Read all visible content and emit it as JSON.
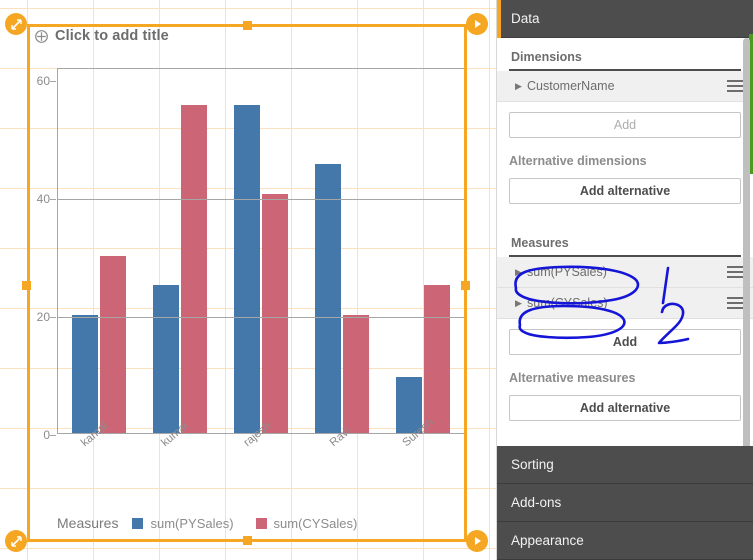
{
  "chart": {
    "title_placeholder": "Click to add title",
    "title_icon": "move-cross-icon",
    "legend_title": "Measures"
  },
  "chart_data": {
    "type": "bar",
    "title": "Click to add title",
    "categories": [
      "kamal",
      "kumar",
      "rajesh",
      "Ravi",
      "Suresh"
    ],
    "series": [
      {
        "name": "sum(PYSales)",
        "color": "#4477aa",
        "values": [
          20,
          25,
          55.5,
          45.5,
          9.5
        ]
      },
      {
        "name": "sum(CYSales)",
        "color": "#cc6677",
        "values": [
          30,
          55.5,
          40.5,
          20,
          25
        ]
      }
    ],
    "xlabel": "",
    "ylabel": "",
    "ylim": [
      0,
      62
    ],
    "yticks": [
      0,
      20,
      40,
      60
    ],
    "ytick_labels": [
      "0",
      "20",
      "40",
      "60"
    ],
    "grid": true,
    "legend_position": "bottom",
    "legend_title": "Measures"
  },
  "panel": {
    "header": "Data",
    "dimensions": {
      "label": "Dimensions",
      "items": [
        {
          "label": "CustomerName"
        }
      ],
      "add_label": "Add",
      "alt_label": "Alternative dimensions",
      "add_alt_label": "Add alternative"
    },
    "measures": {
      "label": "Measures",
      "items": [
        {
          "label": "sum(PYSales)"
        },
        {
          "label": "sum(CYSales)"
        }
      ],
      "add_label": "Add",
      "alt_label": "Alternative measures",
      "add_alt_label": "Add alternative"
    },
    "sections": [
      {
        "label": "Sorting"
      },
      {
        "label": "Add-ons"
      },
      {
        "label": "Appearance"
      }
    ]
  },
  "annotations": {
    "ink_color": "#1515d8",
    "marks": [
      {
        "label": "1",
        "target": "sum(PYSales)"
      },
      {
        "label": "2",
        "target": "sum(CYSales)"
      }
    ]
  }
}
